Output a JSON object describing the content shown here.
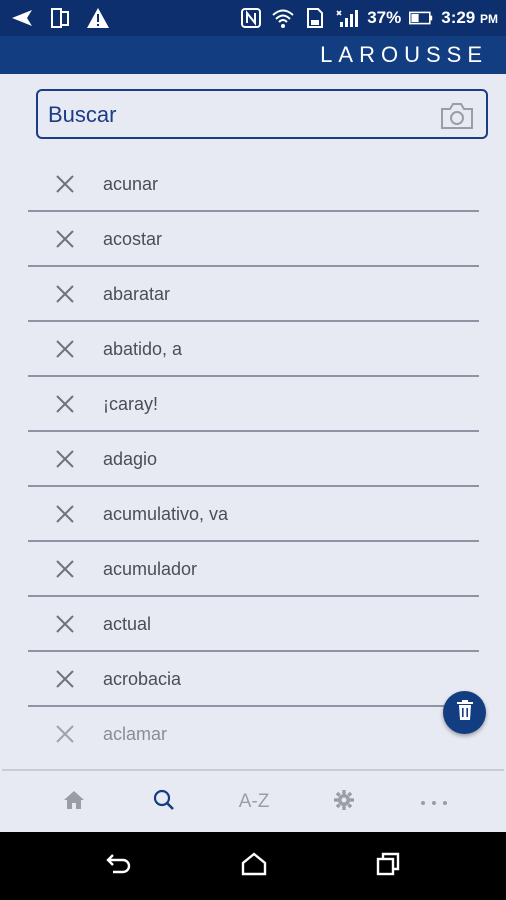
{
  "status_bar": {
    "battery": "37%",
    "time": "3:29",
    "ampm": "PM",
    "icons": [
      "send-icon",
      "tablet-icon",
      "warning-icon",
      "nfc-icon",
      "wifi-icon",
      "sd-card-icon",
      "signal-icon",
      "battery-icon"
    ]
  },
  "app_bar": {
    "brand": "LAROUSSE"
  },
  "search": {
    "placeholder": "Buscar",
    "icon": "camera-icon"
  },
  "history": {
    "items": [
      {
        "word": "acunar"
      },
      {
        "word": "acostar"
      },
      {
        "word": "abaratar"
      },
      {
        "word": "abatido, a"
      },
      {
        "word": "¡caray!"
      },
      {
        "word": "adagio"
      },
      {
        "word": "acumulativo, va"
      },
      {
        "word": "acumulador"
      },
      {
        "word": "actual"
      },
      {
        "word": "acrobacia"
      },
      {
        "word": "aclamar"
      }
    ]
  },
  "fab": {
    "icon": "trash-icon"
  },
  "bottom_nav": {
    "items": [
      {
        "icon": "home-icon"
      },
      {
        "icon": "search-icon",
        "active": true
      },
      {
        "label": "A-Z"
      },
      {
        "icon": "gear-icon"
      },
      {
        "icon": "more-icon"
      }
    ]
  },
  "colors": {
    "brand_blue": "#123d80",
    "status_blue": "#0d2f6e",
    "background": "#e8eaf3",
    "text": "#4b4e59",
    "inactive": "#9a9da8"
  }
}
